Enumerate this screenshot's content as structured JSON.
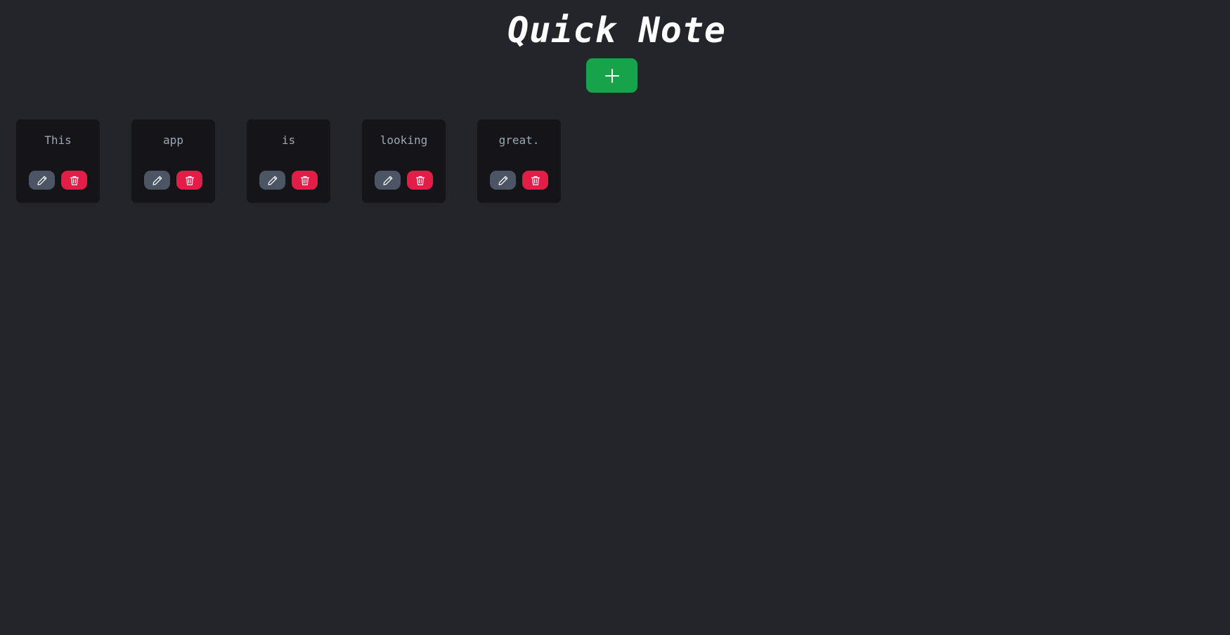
{
  "header": {
    "title": "Quick Note"
  },
  "toolbar": {
    "add_icon": "plus-icon",
    "add_color": "#16a34a"
  },
  "notes": [
    {
      "text": "This"
    },
    {
      "text": "app"
    },
    {
      "text": "is"
    },
    {
      "text": "looking"
    },
    {
      "text": "great."
    }
  ],
  "note_actions": {
    "edit_icon": "pencil-icon",
    "delete_icon": "trash-icon",
    "edit_color": "#4b5563",
    "delete_color": "#e11d48"
  },
  "colors": {
    "background": "#23252a",
    "card": "#141419",
    "note_text": "#9aa9b4"
  }
}
